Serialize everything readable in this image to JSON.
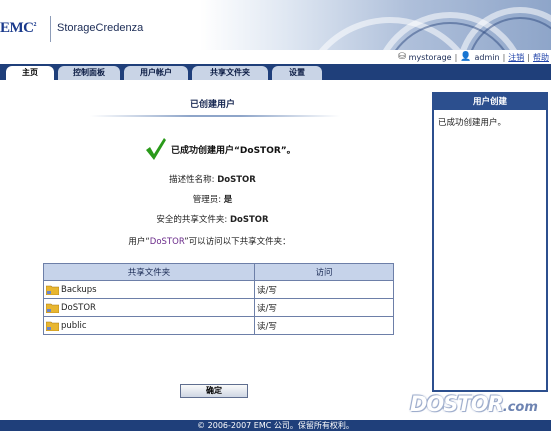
{
  "header": {
    "logo": "EMC",
    "logo_sup": "2",
    "product": "StorageCredenza"
  },
  "userbar": {
    "device": "mystorage",
    "separator": "|",
    "user": "admin",
    "logout": "注销",
    "help": "帮助"
  },
  "tabs": [
    {
      "label": "主页",
      "active": true
    },
    {
      "label": "控制面板",
      "active": false
    },
    {
      "label": "用户帐户",
      "active": false
    },
    {
      "label": "共享文件夹",
      "active": false
    },
    {
      "label": "设置",
      "active": false
    }
  ],
  "main": {
    "title": "已创建用户",
    "success_message": "已成功创建用户“DoSTOR”。",
    "description_label": "描述性名称:",
    "description_value": "DoSTOR",
    "admin_label": "管理员:",
    "admin_value": "是",
    "secure_share_label": "安全的共享文件夹:",
    "secure_share_value": "DoSTOR",
    "access_text_prefix": "用户“",
    "access_text_user": "DoSTOR",
    "access_text_suffix": "”可以访问以下共享文件夹："
  },
  "share_table": {
    "headers": [
      "共享文件夹",
      "访问"
    ],
    "rows": [
      {
        "name": "Backups",
        "access": "读/写"
      },
      {
        "name": "DoSTOR",
        "access": "读/写"
      },
      {
        "name": "public",
        "access": "读/写"
      }
    ]
  },
  "ok_button": "确定",
  "side_panel": {
    "title": "用户创建",
    "body": "已成功创建用户。"
  },
  "footer": "© 2006-2007 EMC 公司。保留所有权利。",
  "watermark": {
    "main": "DOSTOR",
    "suffix": ".com"
  },
  "colors": {
    "navy": "#1f3f7a",
    "panel_border": "#2c4f8e",
    "table_header": "#c6d3ea",
    "check_green": "#2a9a1a"
  }
}
